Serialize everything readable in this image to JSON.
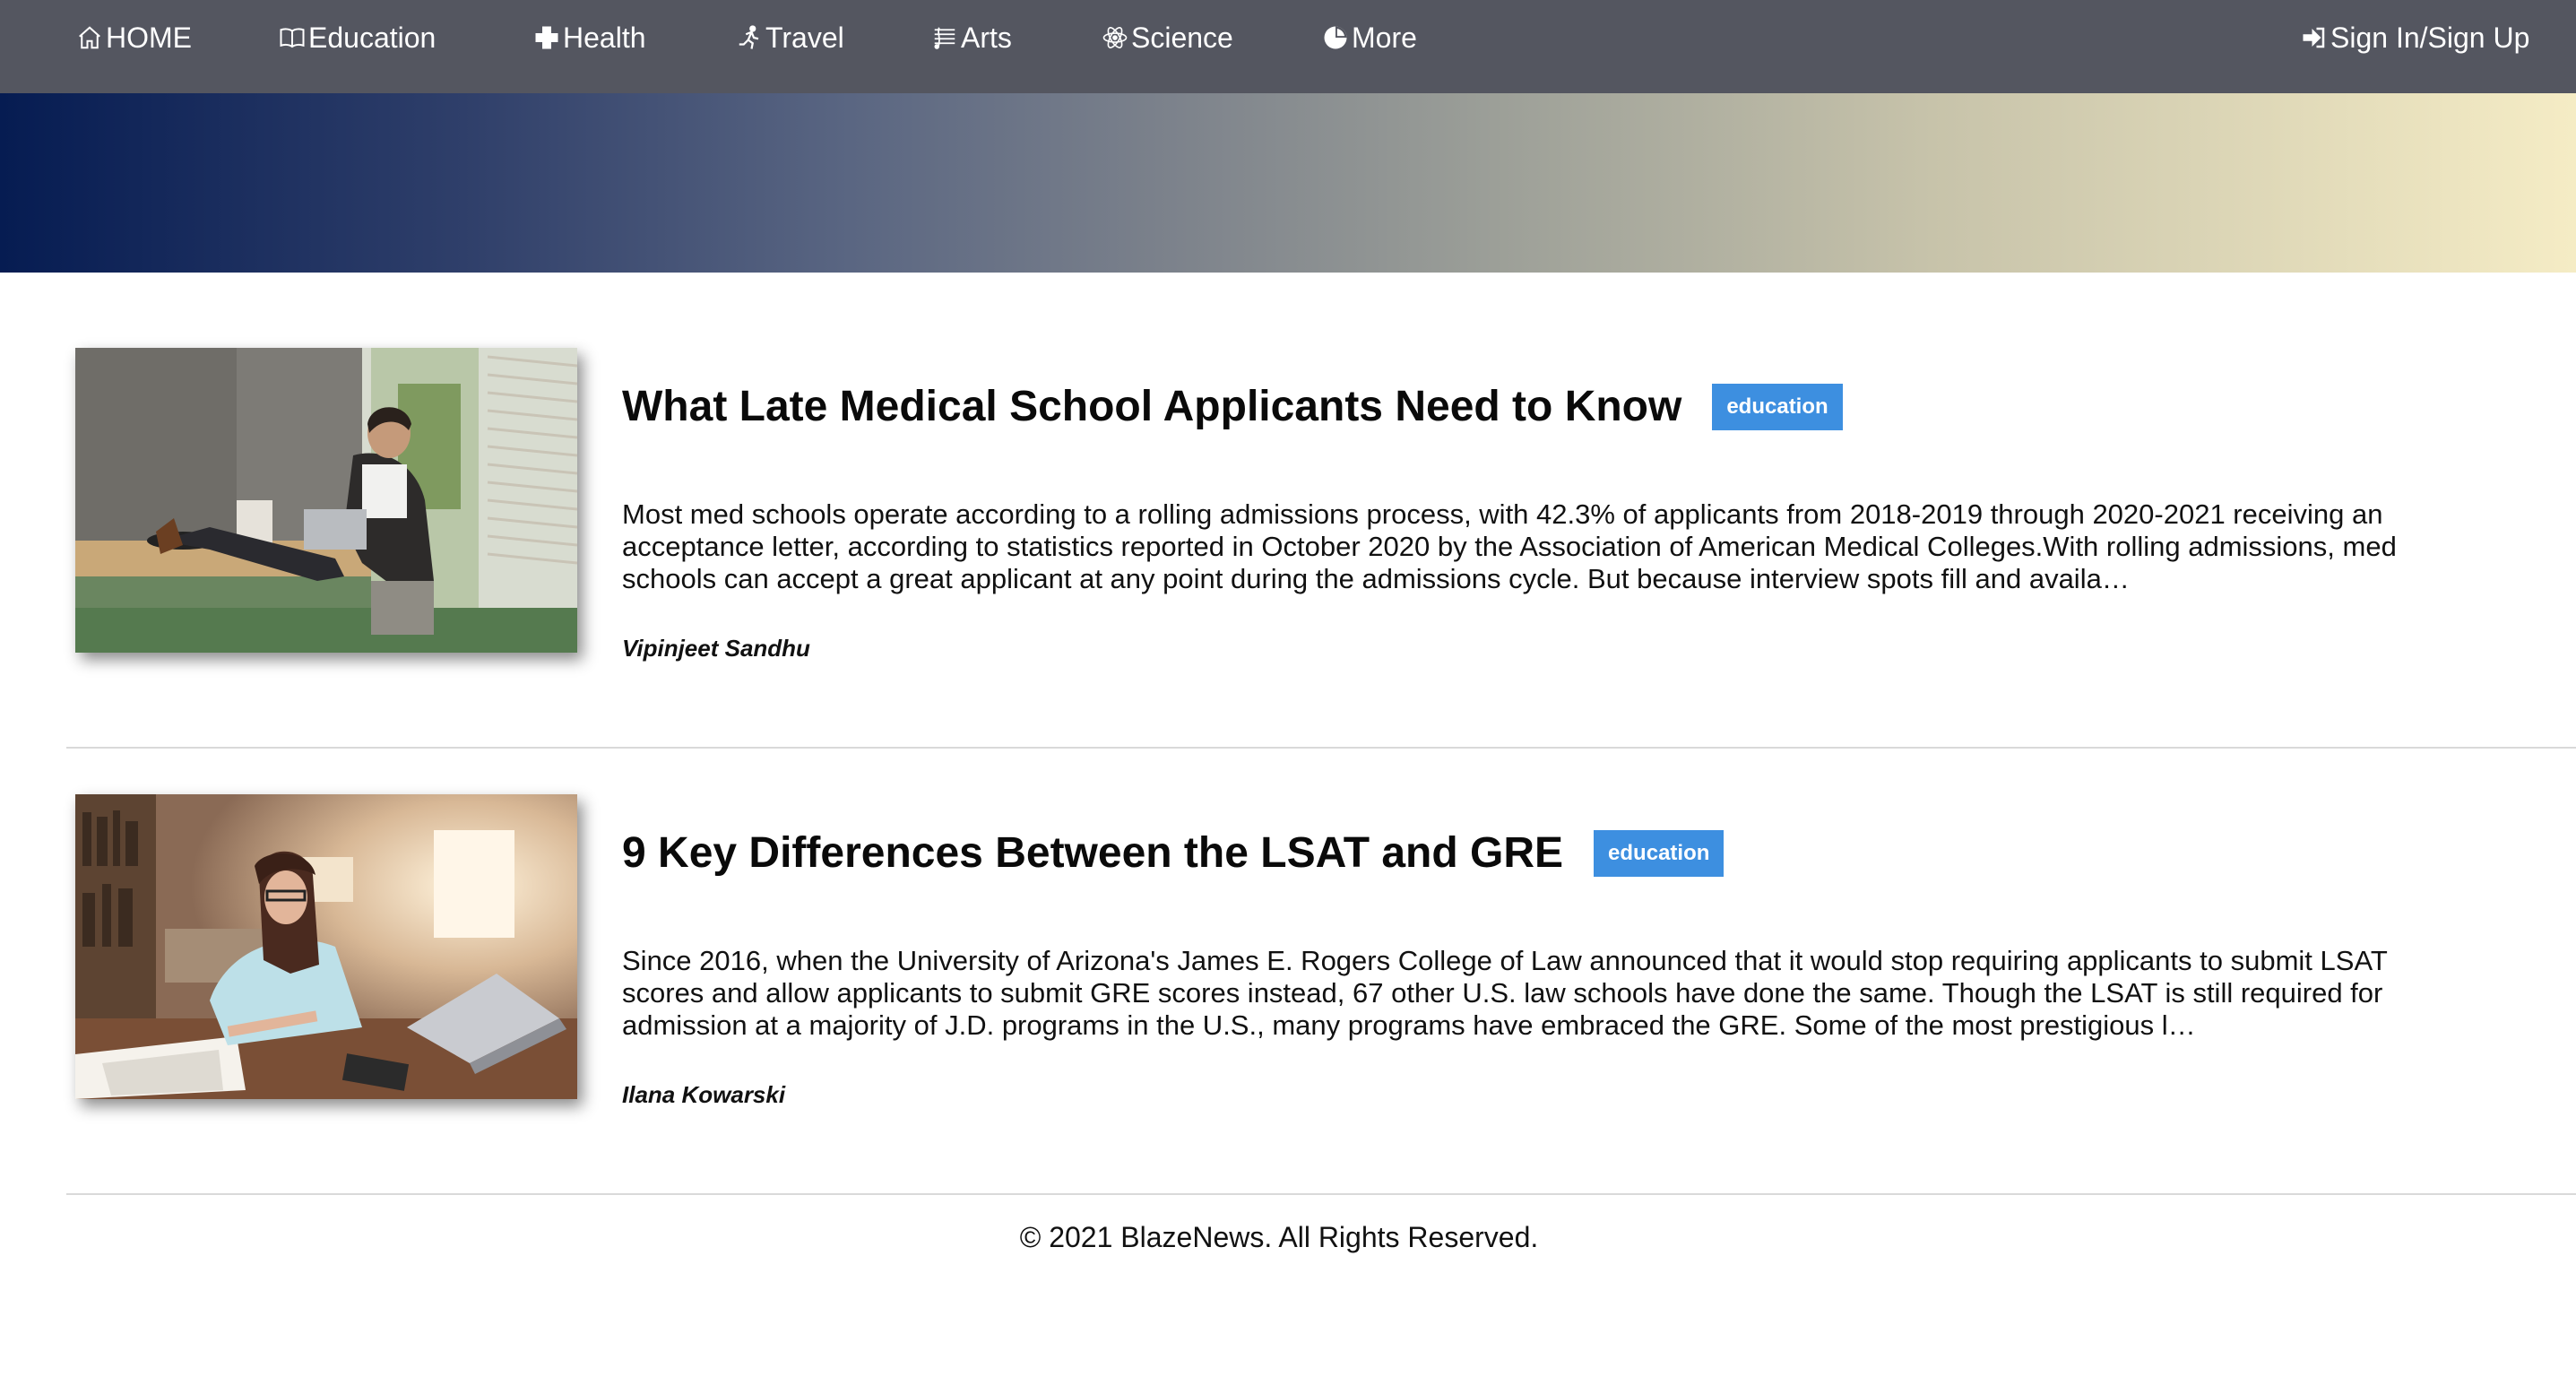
{
  "nav": {
    "items": [
      {
        "label": "HOME",
        "icon": "home-icon"
      },
      {
        "label": " Education",
        "icon": "book-icon"
      },
      {
        "label": "Health",
        "icon": "plus-icon"
      },
      {
        "label": "Travel",
        "icon": "runner-icon"
      },
      {
        "label": "Arts",
        "icon": "music-icon"
      },
      {
        "label": "Science",
        "icon": "atom-icon"
      },
      {
        "label": "More",
        "icon": "pie-icon"
      }
    ],
    "signin": {
      "label": "Sign In/Sign Up",
      "icon": "sign-in-icon"
    }
  },
  "articles": [
    {
      "title": "What Late Medical School Applicants Need to Know",
      "badge": "education",
      "excerpt": "Most med schools operate according to a rolling admissions process, with 42.3% of applicants from 2018-2019 through 2020-2021 receiving an acceptance letter, according to statistics reported in October 2020 by the Association of American Medical Colleges.With rolling admissions, med schools can accept a great applicant at any point during the admissions cycle. But because interview spots fill and availa…",
      "author": "Vipinjeet Sandhu",
      "image": "man-with-laptop-photo"
    },
    {
      "title": "9 Key Differences Between the LSAT and GRE",
      "badge": "education",
      "excerpt": "Since 2016, when the University of Arizona's James E. Rogers College of Law announced that it would stop requiring applicants to submit LSAT scores and allow applicants to submit GRE scores instead, 67 other U.S. law schools have done the same. Though the LSAT is still required for admission at a majority of J.D. programs in the U.S., many programs have embraced the GRE. Some of the most prestigious l…",
      "author": "Ilana Kowarski",
      "image": "woman-studying-photo"
    }
  ],
  "footer": {
    "text": "©  2021 BlazeNews. All Rights Reserved."
  },
  "colors": {
    "navbar": "#545660",
    "badge": "#3d8fe0",
    "banner_start": "#061c52",
    "banner_end": "#f5ecc5"
  }
}
